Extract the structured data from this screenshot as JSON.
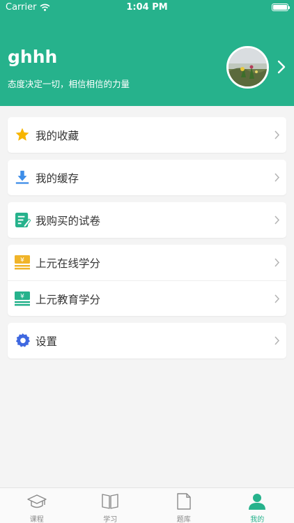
{
  "status_bar": {
    "carrier": "Carrier",
    "time": "1:04 PM"
  },
  "profile": {
    "username": "ghhh",
    "motto": "态度决定一切，相信相信的力量"
  },
  "menu": {
    "favorites": "我的收藏",
    "cache": "我的缓存",
    "purchased_papers": "我购买的试卷",
    "shangyuan_online_credits": "上元在线学分",
    "shangyuan_education_credits": "上元教育学分",
    "settings": "设置"
  },
  "tabbar": {
    "items": [
      {
        "label": "课程",
        "icon": "graduation-cap-icon",
        "active": false
      },
      {
        "label": "学习",
        "icon": "open-book-icon",
        "active": false
      },
      {
        "label": "题库",
        "icon": "document-icon",
        "active": false
      },
      {
        "label": "我的",
        "icon": "person-icon",
        "active": true
      }
    ]
  },
  "colors": {
    "accent": "#26b28c",
    "star": "#f7b500",
    "download": "#3d8de8",
    "settings": "#3f68e0",
    "credit_yellow": "#f0b429"
  }
}
